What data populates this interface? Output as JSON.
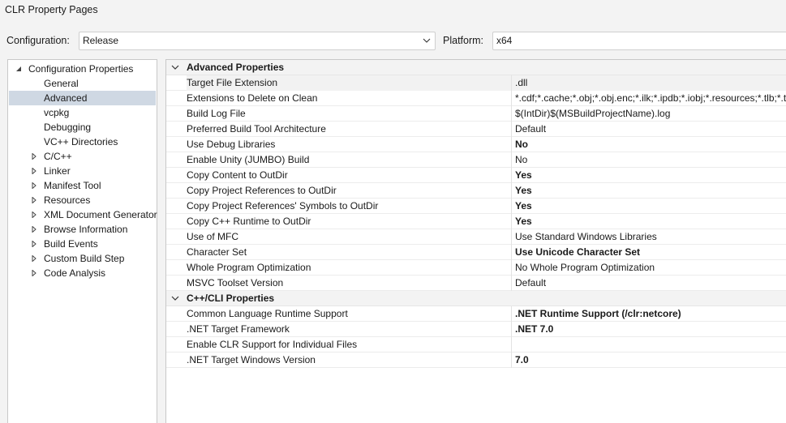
{
  "window": {
    "title": "CLR Property Pages"
  },
  "config": {
    "configuration_label": "Configuration:",
    "configuration_value": "Release",
    "platform_label": "Platform:",
    "platform_value": "x64"
  },
  "tree": {
    "root": "Configuration Properties",
    "items": [
      {
        "label": "General",
        "expandable": false
      },
      {
        "label": "Advanced",
        "expandable": false,
        "selected": true
      },
      {
        "label": "vcpkg",
        "expandable": false
      },
      {
        "label": "Debugging",
        "expandable": false
      },
      {
        "label": "VC++ Directories",
        "expandable": false
      },
      {
        "label": "C/C++",
        "expandable": true
      },
      {
        "label": "Linker",
        "expandable": true
      },
      {
        "label": "Manifest Tool",
        "expandable": true
      },
      {
        "label": "Resources",
        "expandable": true
      },
      {
        "label": "XML Document Generator",
        "expandable": true
      },
      {
        "label": "Browse Information",
        "expandable": true
      },
      {
        "label": "Build Events",
        "expandable": true
      },
      {
        "label": "Custom Build Step",
        "expandable": true
      },
      {
        "label": "Code Analysis",
        "expandable": true
      }
    ]
  },
  "grid": {
    "categories": [
      {
        "label": "Advanced Properties",
        "rows": [
          {
            "name": "Target File Extension",
            "value": ".dll",
            "bold": false
          },
          {
            "name": "Extensions to Delete on Clean",
            "value": "*.cdf;*.cache;*.obj;*.obj.enc;*.ilk;*.ipdb;*.iobj;*.resources;*.tlb;*.t",
            "bold": false
          },
          {
            "name": "Build Log File",
            "value": "$(IntDir)$(MSBuildProjectName).log",
            "bold": false
          },
          {
            "name": "Preferred Build Tool Architecture",
            "value": "Default",
            "bold": false
          },
          {
            "name": "Use Debug Libraries",
            "value": "No",
            "bold": true
          },
          {
            "name": "Enable Unity (JUMBO) Build",
            "value": "No",
            "bold": false
          },
          {
            "name": "Copy Content to OutDir",
            "value": "Yes",
            "bold": true
          },
          {
            "name": "Copy Project References to OutDir",
            "value": "Yes",
            "bold": true
          },
          {
            "name": "Copy Project References' Symbols to OutDir",
            "value": "Yes",
            "bold": true
          },
          {
            "name": "Copy C++ Runtime to OutDir",
            "value": "Yes",
            "bold": true
          },
          {
            "name": "Use of MFC",
            "value": "Use Standard Windows Libraries",
            "bold": false
          },
          {
            "name": "Character Set",
            "value": "Use Unicode Character Set",
            "bold": true
          },
          {
            "name": "Whole Program Optimization",
            "value": "No Whole Program Optimization",
            "bold": false
          },
          {
            "name": "MSVC Toolset Version",
            "value": "Default",
            "bold": false
          }
        ]
      },
      {
        "label": "C++/CLI Properties",
        "rows": [
          {
            "name": "Common Language Runtime Support",
            "value": ".NET Runtime Support (/clr:netcore)",
            "bold": true
          },
          {
            "name": ".NET Target Framework",
            "value": ".NET 7.0",
            "bold": true
          },
          {
            "name": "Enable CLR Support for Individual Files",
            "value": "",
            "bold": false
          },
          {
            "name": ".NET Target Windows Version",
            "value": "7.0",
            "bold": true
          }
        ]
      }
    ]
  }
}
